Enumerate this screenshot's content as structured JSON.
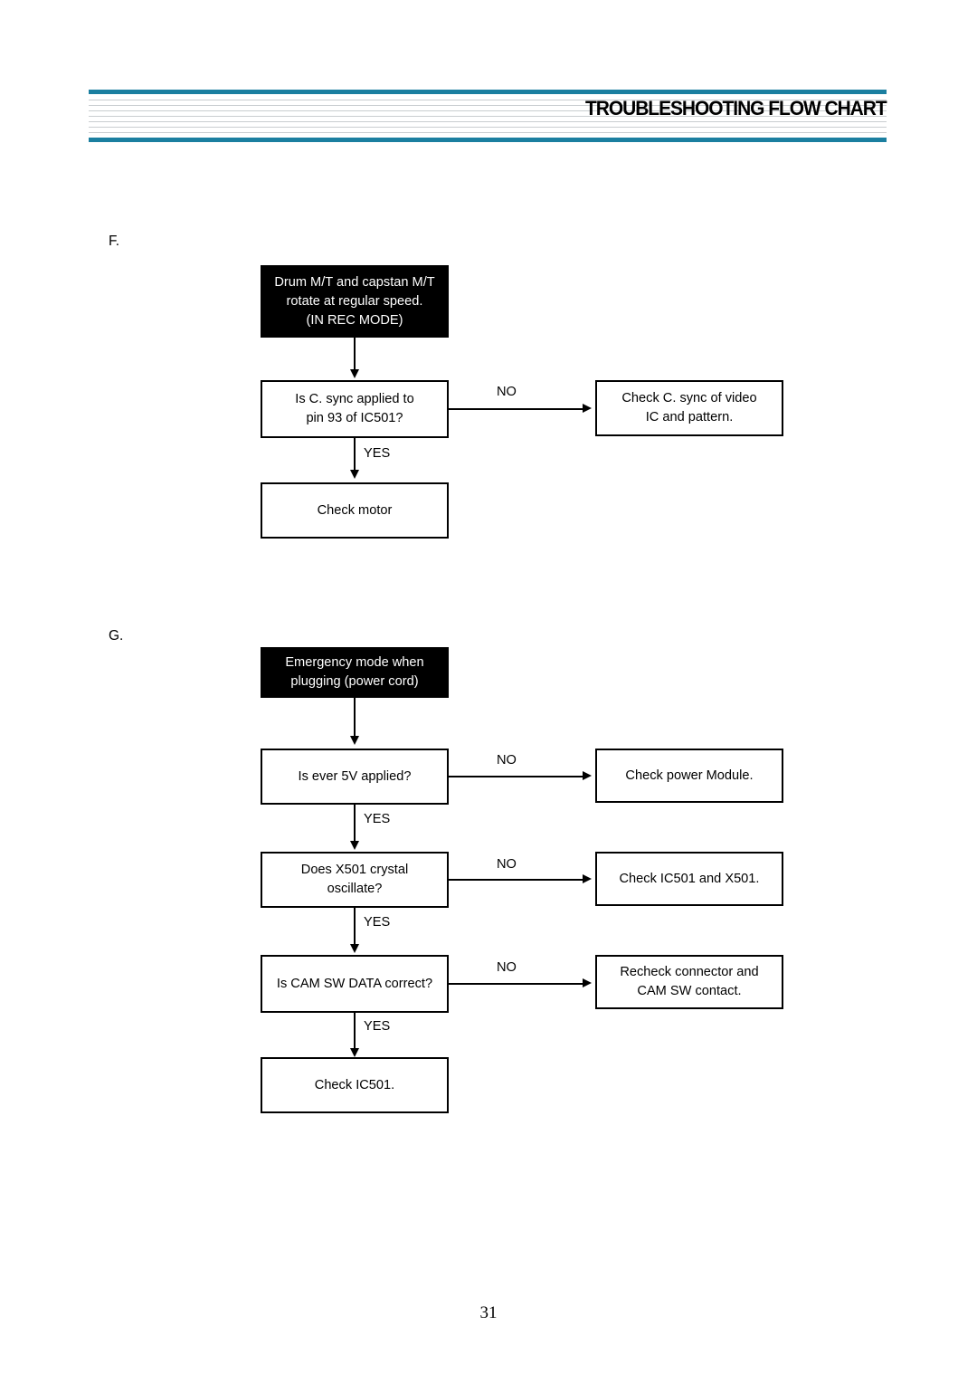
{
  "header": {
    "title": "TROUBLESHOOTING FLOW CHART",
    "accent_color": "#1b7fa0",
    "stripe_color": "#c9cdd0",
    "stripe_count": 7
  },
  "page": {
    "number": "31"
  },
  "sections": [
    {
      "letter": "F.",
      "start_box": "Drum M/T and capstan M/T\nrotate at regular speed.\n(IN REC MODE)",
      "steps": [
        {
          "question": "Is C. sync applied to\npin 93 of IC501?",
          "no_label": "NO",
          "no_target": "Check C. sync of video\nIC and pattern.",
          "yes_label": "YES"
        }
      ],
      "end_box": "Check motor"
    },
    {
      "letter": "G.",
      "start_box": "Emergency mode when\nplugging (power cord)",
      "steps": [
        {
          "question": "Is ever 5V applied?",
          "no_label": "NO",
          "no_target": "Check power Module.",
          "yes_label": "YES"
        },
        {
          "question": "Does X501 crystal\noscillate?",
          "no_label": "NO",
          "no_target": "Check IC501 and X501.",
          "yes_label": "YES"
        },
        {
          "question": "Is CAM SW DATA correct?",
          "no_label": "NO",
          "no_target": "Recheck connector and\nCAM SW contact.",
          "yes_label": "YES"
        }
      ],
      "end_box": "Check IC501."
    }
  ]
}
